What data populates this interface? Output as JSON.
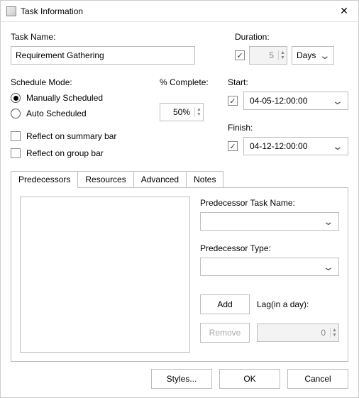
{
  "window": {
    "title": "Task Information"
  },
  "task": {
    "name_label": "Task Name:",
    "name_value": "Requirement Gathering"
  },
  "duration": {
    "label": "Duration:",
    "enabled": true,
    "value": "5",
    "unit": "Days"
  },
  "schedule": {
    "mode_label": "Schedule Mode:",
    "manual_label": "Manually Scheduled",
    "auto_label": "Auto Scheduled",
    "selected": "manual"
  },
  "percent": {
    "label": "% Complete:",
    "value": "50%"
  },
  "reflect": {
    "summary_label": "Reflect on summary bar",
    "summary_checked": false,
    "group_label": "Reflect on group bar",
    "group_checked": false
  },
  "start": {
    "label": "Start:",
    "enabled": true,
    "value": "04-05-12:00:00"
  },
  "finish": {
    "label": "Finish:",
    "enabled": true,
    "value": "04-12-12:00:00"
  },
  "tabs": {
    "items": [
      "Predecessors",
      "Resources",
      "Advanced",
      "Notes"
    ],
    "active": 0
  },
  "predecessor": {
    "name_label": "Predecessor Task Name:",
    "type_label": "Predecessor Type:",
    "add_label": "Add",
    "remove_label": "Remove",
    "lag_label": "Lag(in a day):",
    "lag_value": "0"
  },
  "footer": {
    "styles_label": "Styles...",
    "ok_label": "OK",
    "cancel_label": "Cancel"
  }
}
